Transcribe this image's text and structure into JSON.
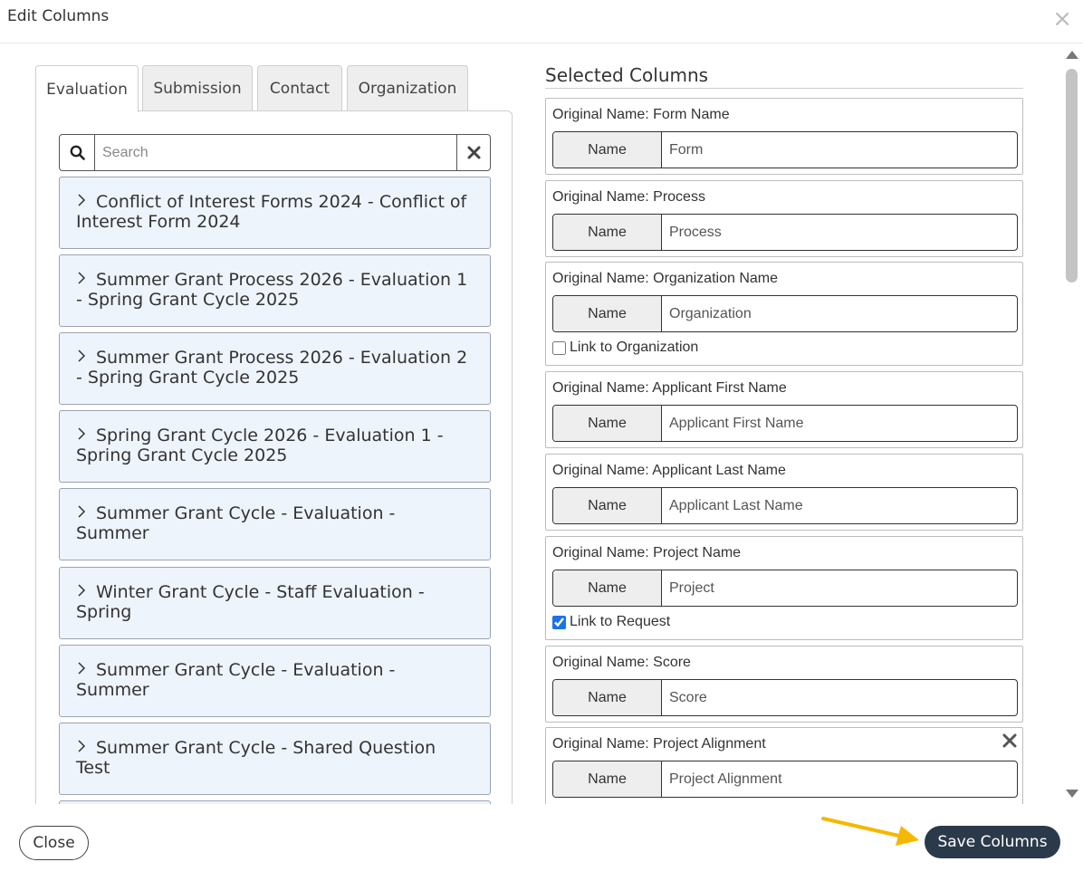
{
  "dialog": {
    "title": "Edit Columns",
    "close_icon_glyph": "×"
  },
  "tabs": [
    {
      "label": "Evaluation",
      "active": true
    },
    {
      "label": "Submission",
      "active": false
    },
    {
      "label": "Contact",
      "active": false
    },
    {
      "label": "Organization",
      "active": false
    }
  ],
  "search": {
    "placeholder": "Search",
    "value": "",
    "icon": "search-icon",
    "clear_icon": "close-icon"
  },
  "groups": [
    {
      "label": "Conflict of Interest Forms 2024 - Conflict of Interest Form 2024"
    },
    {
      "label": "Summer Grant Process 2026 - Evaluation 1 - Spring Grant Cycle 2025"
    },
    {
      "label": "Summer Grant Process 2026 - Evaluation 2 - Spring Grant Cycle 2025"
    },
    {
      "label": "Spring Grant Cycle 2026 - Evaluation 1 - Spring Grant Cycle 2025"
    },
    {
      "label": "Summer Grant Cycle - Evaluation - Summer"
    },
    {
      "label": "Winter Grant Cycle - Staff Evaluation - Spring"
    },
    {
      "label": "Summer Grant Cycle - Evaluation - Summer"
    },
    {
      "label": "Summer Grant Cycle - Shared Question Test"
    }
  ],
  "group_chevron": "›",
  "selected": {
    "title": "Selected Columns",
    "name_addon": "Name",
    "columns": [
      {
        "original": "Original Name: Form Name",
        "value": "Form"
      },
      {
        "original": "Original Name: Process",
        "value": "Process"
      },
      {
        "original": "Original Name: Organization Name",
        "value": "Organization",
        "link_label": "Link to Organization",
        "link_checked": false
      },
      {
        "original": "Original Name: Applicant First Name",
        "value": "Applicant First Name"
      },
      {
        "original": "Original Name: Applicant Last Name",
        "value": "Applicant Last Name"
      },
      {
        "original": "Original Name: Project Name",
        "value": "Project",
        "link_label": "Link to Request",
        "link_checked": true
      },
      {
        "original": "Original Name: Score",
        "value": "Score"
      },
      {
        "original": "Original Name: Project Alignment",
        "value": "Project Alignment",
        "removable": true
      }
    ]
  },
  "footer": {
    "close_label": "Close",
    "save_label": "Save Columns"
  },
  "colors": {
    "save_button_bg": "#2b3a4b",
    "group_bg": "#eef4fc",
    "arrow": "#f5b800",
    "checkbox_accent": "#1a73e8"
  }
}
